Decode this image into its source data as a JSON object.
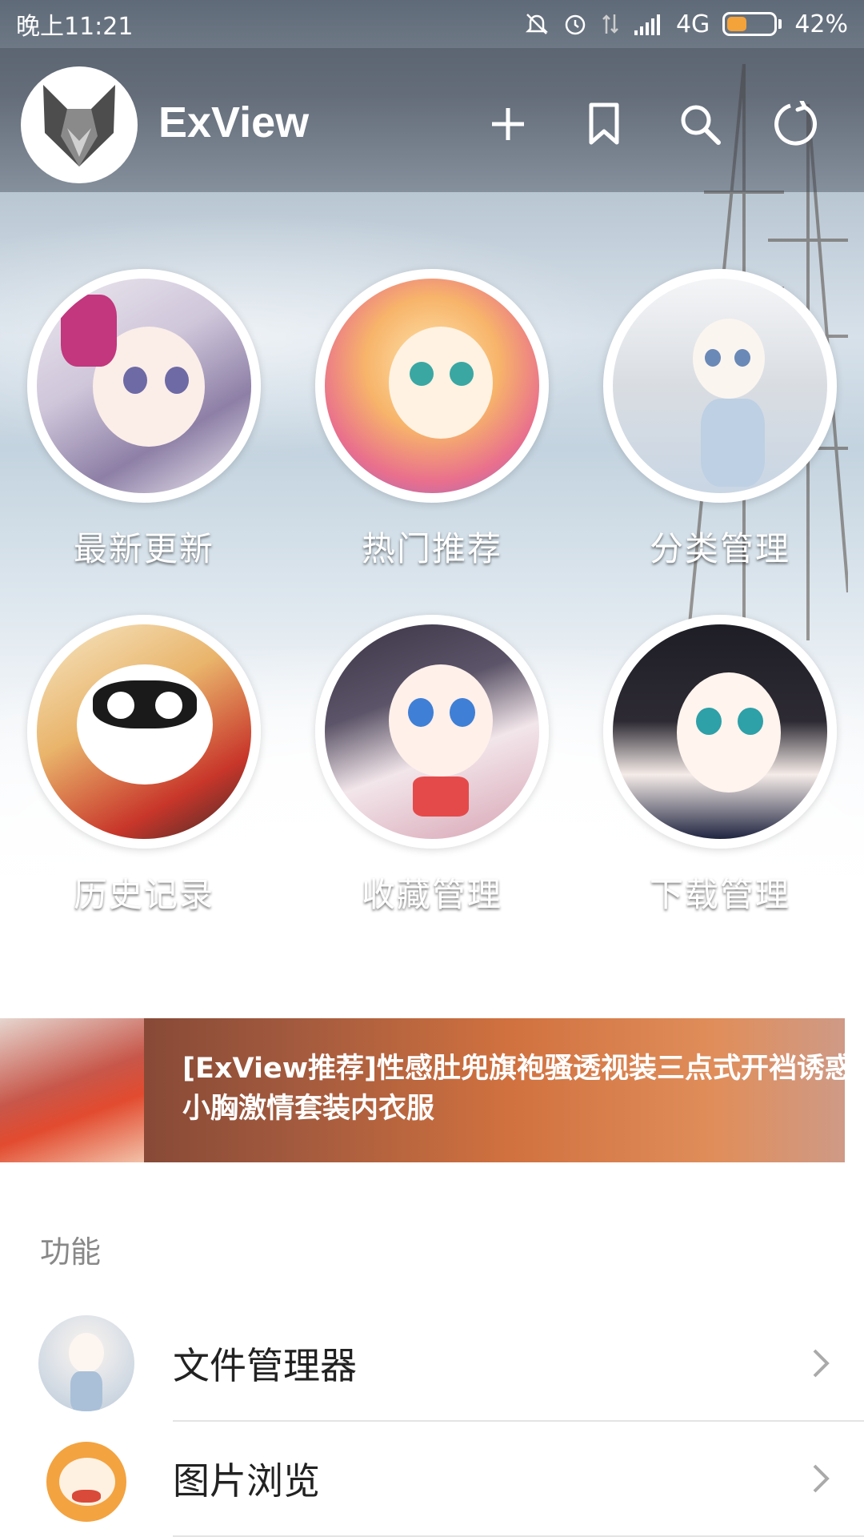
{
  "status_bar": {
    "time": "晚上11:21",
    "network": "4G",
    "battery_percent": "42%",
    "battery_level": 0.42,
    "icons": [
      "silent-icon",
      "alarm-icon",
      "data-arrows-icon",
      "signal-icon",
      "battery-icon"
    ]
  },
  "app_bar": {
    "title": "ExView",
    "actions": [
      "add-icon",
      "bookmark-icon",
      "search-icon",
      "refresh-icon"
    ]
  },
  "categories": [
    {
      "label": "最新更新"
    },
    {
      "label": "热门推荐"
    },
    {
      "label": "分类管理"
    },
    {
      "label": "历史记录"
    },
    {
      "label": "收藏管理"
    },
    {
      "label": "下载管理"
    }
  ],
  "banner": {
    "line1": "[ExView推荐]性感肚兜旗袍骚透视装三点式开裆诱惑",
    "line2": "小胸激情套装内衣服"
  },
  "section": {
    "title": "功能",
    "items": [
      {
        "label": "文件管理器"
      },
      {
        "label": "图片浏览"
      }
    ]
  },
  "colors": {
    "accent_battery": "#f4a23a",
    "text_primary": "#222222",
    "section_title": "#888888"
  }
}
